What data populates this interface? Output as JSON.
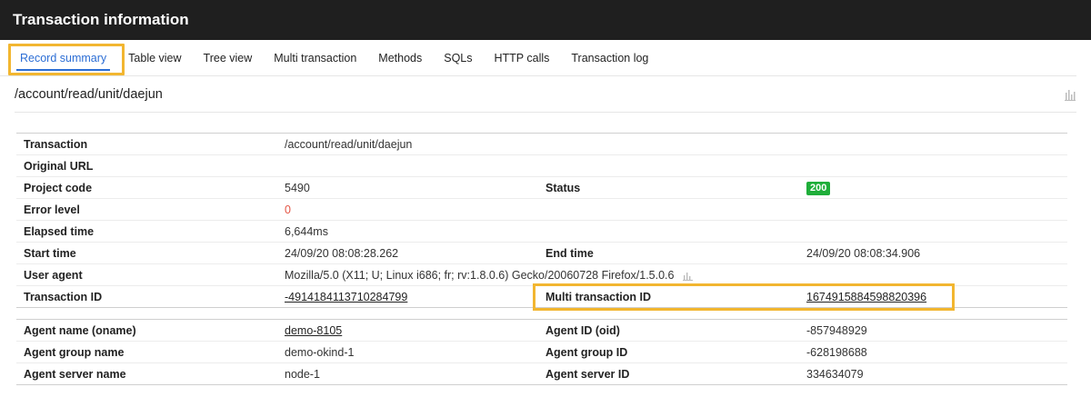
{
  "window": {
    "title": "Transaction information"
  },
  "tabs": [
    {
      "label": "Record summary",
      "active": true
    },
    {
      "label": "Table view"
    },
    {
      "label": "Tree view"
    },
    {
      "label": "Multi transaction"
    },
    {
      "label": "Methods"
    },
    {
      "label": "SQLs"
    },
    {
      "label": "HTTP calls"
    },
    {
      "label": "Transaction log"
    }
  ],
  "path": {
    "title": "/account/read/unit/daejun",
    "chart_icon": "bar-chart-icon"
  },
  "summary": {
    "transaction_label": "Transaction",
    "transaction_value": "/account/read/unit/daejun",
    "original_url_label": "Original URL",
    "original_url_value": "",
    "project_code_label": "Project code",
    "project_code_value": "5490",
    "status_label": "Status",
    "status_value": "200",
    "error_level_label": "Error level",
    "error_level_value": "0",
    "elapsed_label": "Elapsed time",
    "elapsed_value": "6,644ms",
    "start_label": "Start time",
    "start_value": "24/09/20 08:08:28.262",
    "end_label": "End time",
    "end_value": "24/09/20 08:08:34.906",
    "user_agent_label": "User agent",
    "user_agent_value": "Mozilla/5.0 (X11; U; Linux i686; fr; rv:1.8.0.6) Gecko/20060728 Firefox/1.5.0.6",
    "txid_label": "Transaction ID",
    "txid_value": "-4914184113710284799",
    "mtxid_label": "Multi transaction ID",
    "mtxid_value": "1674915884598820396"
  },
  "agent": {
    "oname_label": "Agent name (oname)",
    "oname_value": "demo-8105",
    "oid_label": "Agent ID (oid)",
    "oid_value": "-857948929",
    "group_name_label": "Agent group name",
    "group_name_value": "demo-okind-1",
    "group_id_label": "Agent group ID",
    "group_id_value": "-628198688",
    "server_name_label": "Agent server name",
    "server_name_value": "node-1",
    "server_id_label": "Agent server ID",
    "server_id_value": "334634079"
  },
  "colors": {
    "accent": "#2c6ed5",
    "highlight": "#f2b630",
    "status_ok": "#1fae3a",
    "error": "#e45545",
    "titlebar": "#1f1f1f"
  }
}
